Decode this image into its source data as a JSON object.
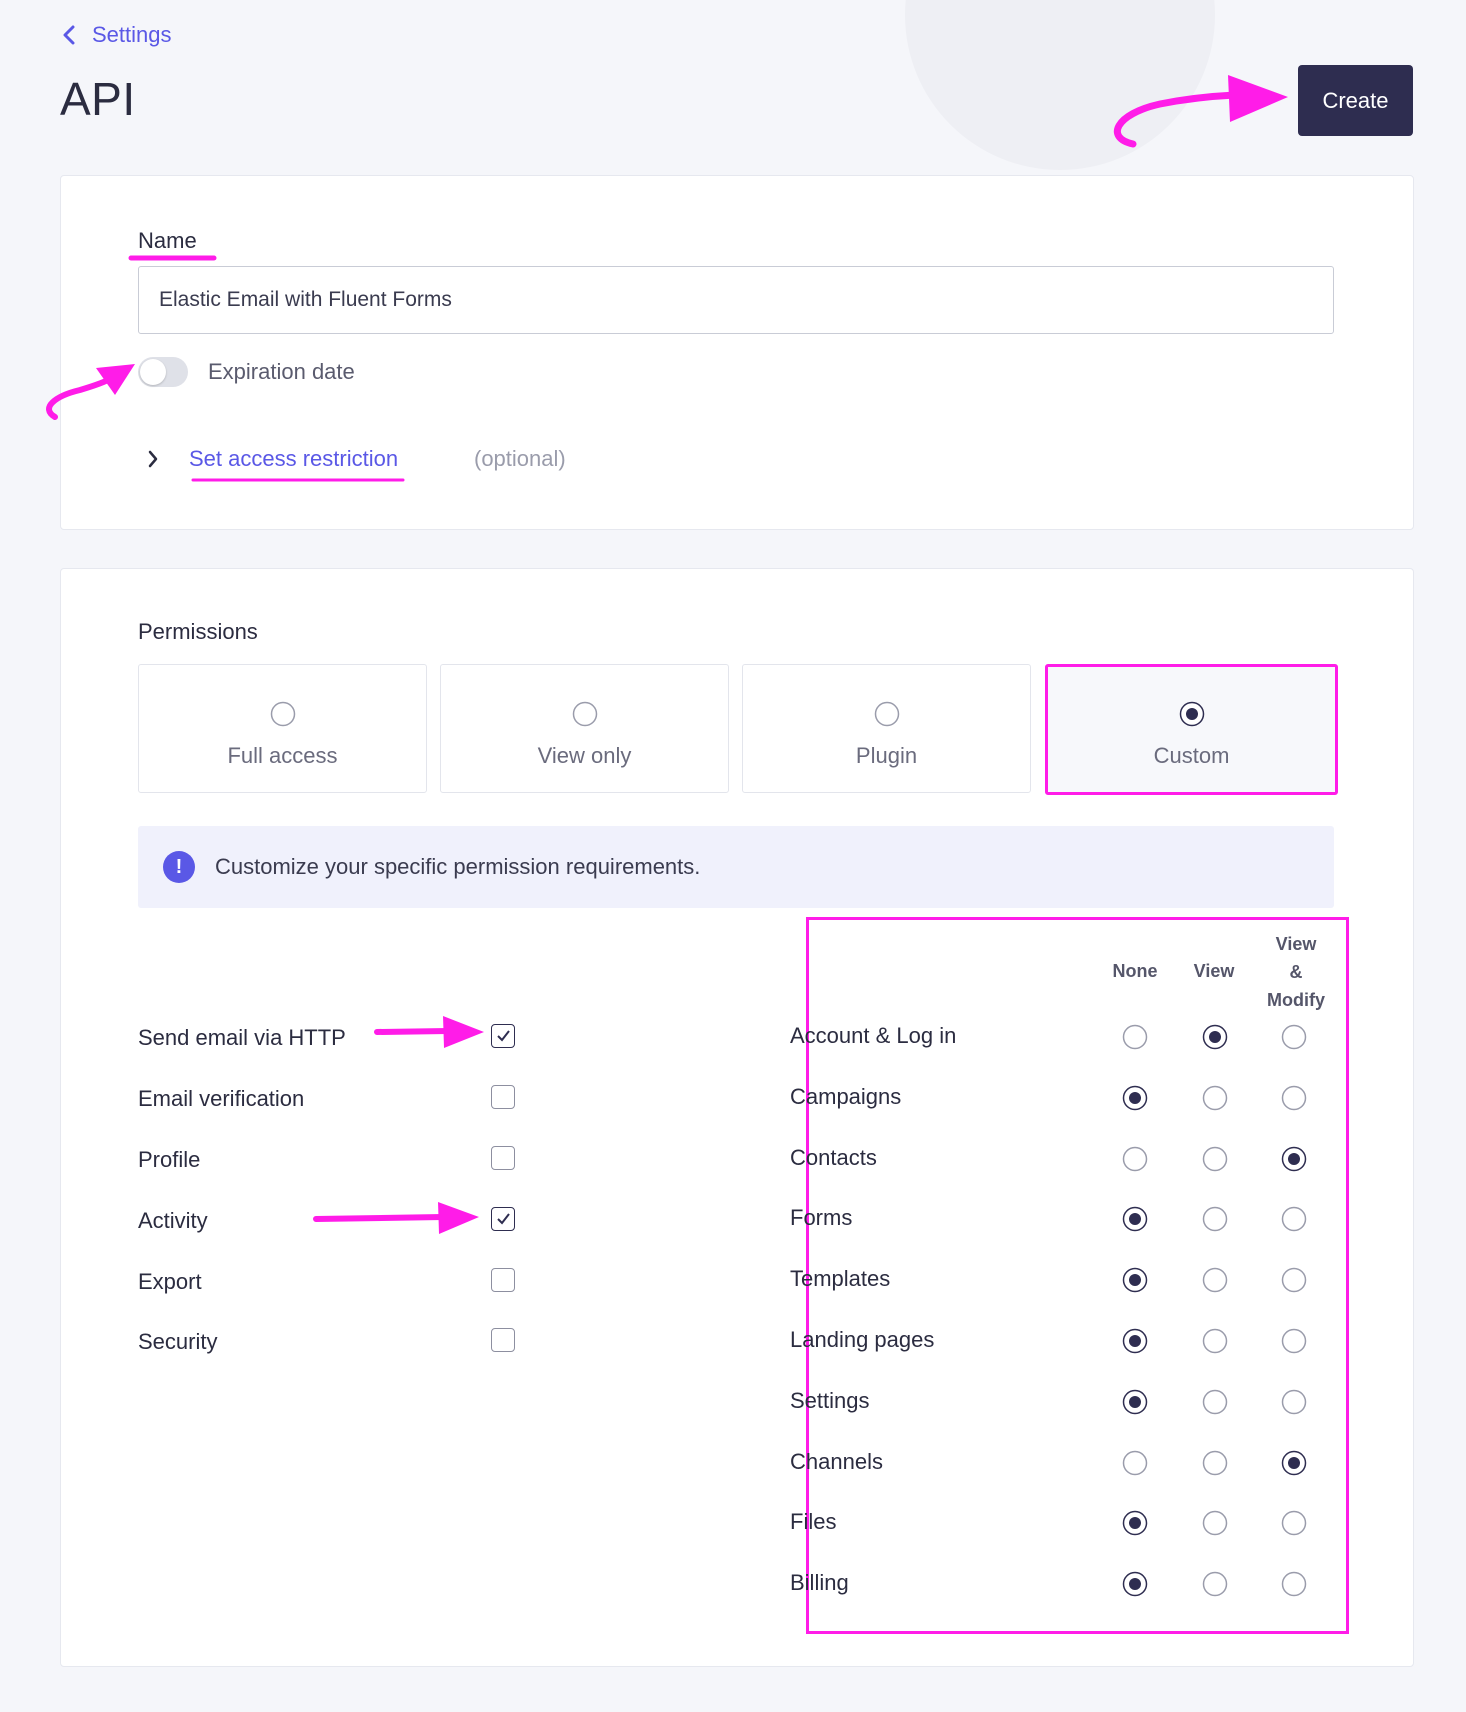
{
  "nav": {
    "back_label": "Settings"
  },
  "page": {
    "title": "API"
  },
  "toolbar": {
    "create_label": "Create"
  },
  "form": {
    "name_label": "Name",
    "name_value": "Elastic Email with Fluent Forms",
    "expiration_label": "Expiration date",
    "expiration_enabled": false,
    "access_link": "Set access restriction",
    "access_optional": "(optional)"
  },
  "permissions": {
    "title": "Permissions",
    "options": [
      {
        "label": "Full access",
        "selected": false
      },
      {
        "label": "View only",
        "selected": false
      },
      {
        "label": "Plugin",
        "selected": false
      },
      {
        "label": "Custom",
        "selected": true
      }
    ],
    "info_text": "Customize your specific permission requirements.",
    "checkboxes": [
      {
        "label": "Send email via HTTP",
        "checked": true
      },
      {
        "label": "Email verification",
        "checked": false
      },
      {
        "label": "Profile",
        "checked": false
      },
      {
        "label": "Activity",
        "checked": true
      },
      {
        "label": "Export",
        "checked": false
      },
      {
        "label": "Security",
        "checked": false
      }
    ],
    "matrix_headers": {
      "none": "None",
      "view": "View",
      "modify_line1": "View",
      "modify_line2": "&",
      "modify_line3": "Modify"
    },
    "matrix": [
      {
        "label": "Account & Log in",
        "level": "View"
      },
      {
        "label": "Campaigns",
        "level": "None"
      },
      {
        "label": "Contacts",
        "level": "View & Modify"
      },
      {
        "label": "Forms",
        "level": "None"
      },
      {
        "label": "Templates",
        "level": "None"
      },
      {
        "label": "Landing pages",
        "level": "None"
      },
      {
        "label": "Settings",
        "level": "None"
      },
      {
        "label": "Channels",
        "level": "View & Modify"
      },
      {
        "label": "Files",
        "level": "None"
      },
      {
        "label": "Billing",
        "level": "None"
      }
    ]
  },
  "colors": {
    "accent": "#5a58e6",
    "primary_button": "#2e2d50",
    "annotation": "#ff1ce8"
  }
}
